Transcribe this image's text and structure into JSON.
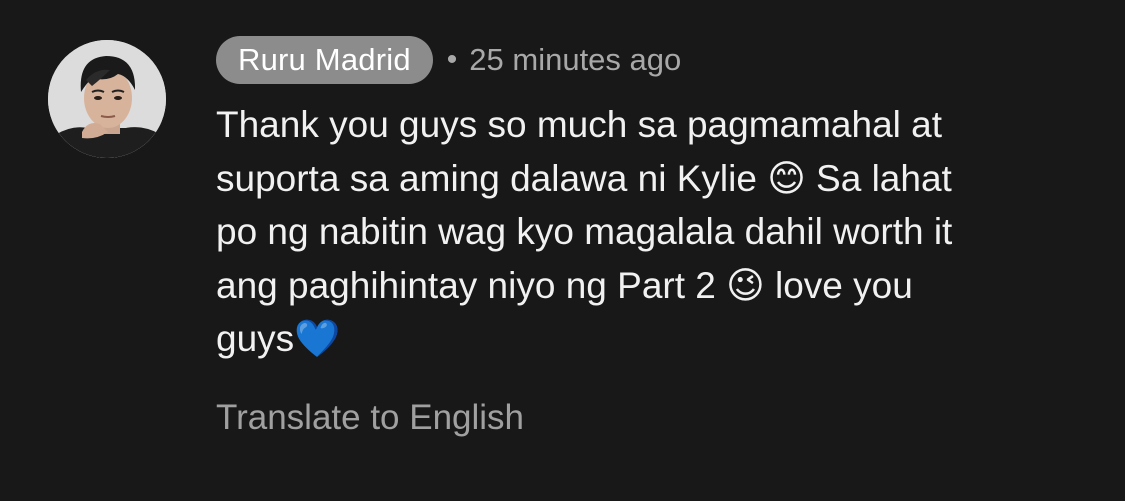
{
  "comment": {
    "author": "Ruru Madrid",
    "separator": "•",
    "timestamp": "25 minutes ago",
    "text": "Thank you guys so much sa pagmamahal at\nsuporta sa aming dalawa ni Kylie 😊 Sa lahat\npo ng nabitin wag kyo magalala dahil worth it\nang paghihintay niyo ng Part 2 😉 love you\nguys💙",
    "translate_label": "Translate to English"
  },
  "icons": {
    "avatar": "user-avatar-photo"
  },
  "colors": {
    "background": "#181818",
    "author_chip": "#8c8c8c",
    "text": "#f1f1f1",
    "muted": "#a8a8a8"
  }
}
